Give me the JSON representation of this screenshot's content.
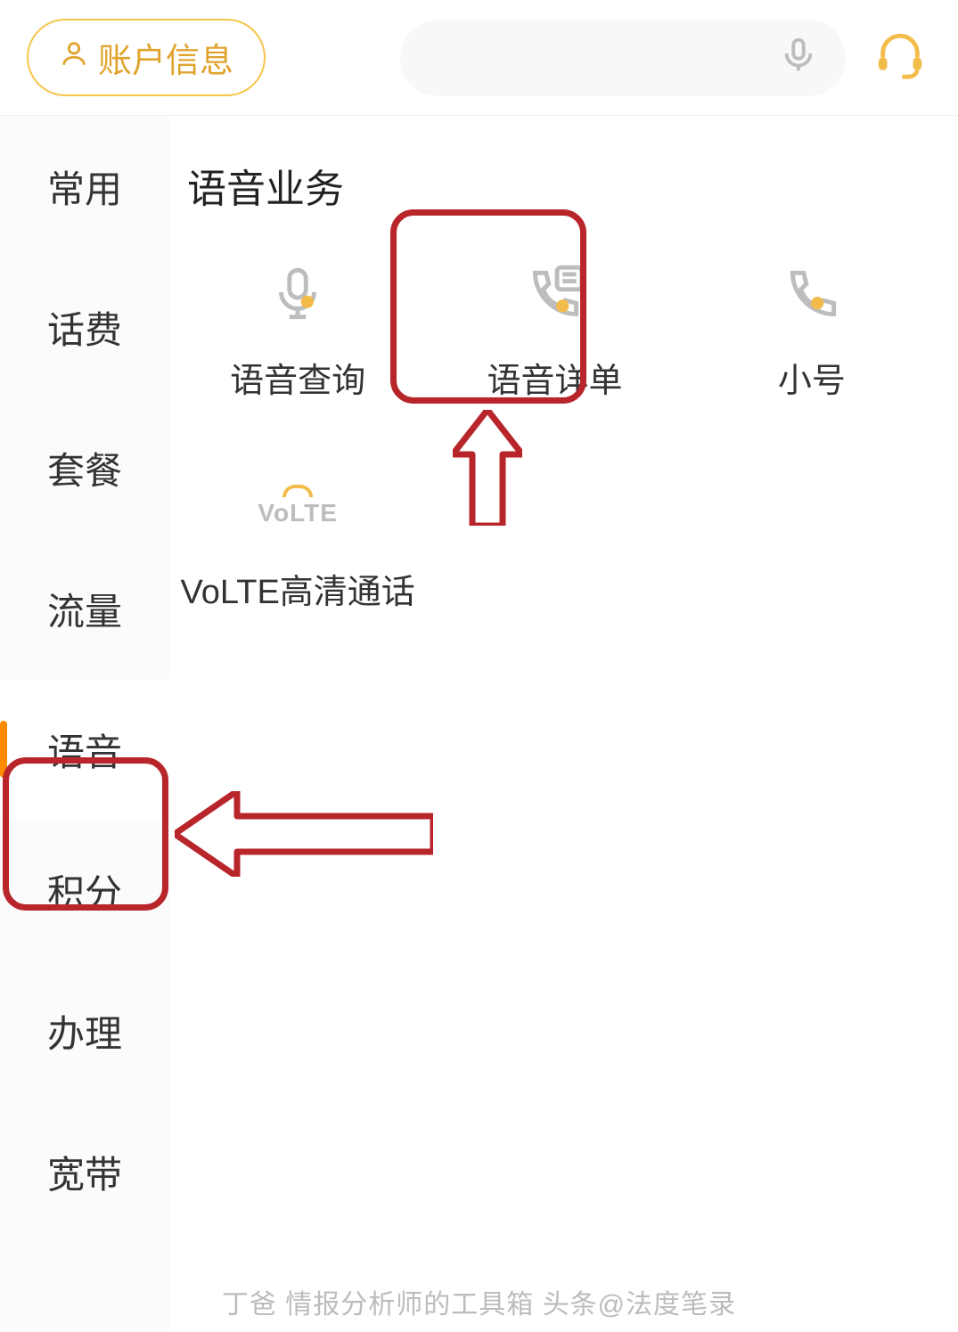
{
  "header": {
    "account_label": "账户信息"
  },
  "sidebar": {
    "items": [
      {
        "label": "常用",
        "active": false
      },
      {
        "label": "话费",
        "active": false
      },
      {
        "label": "套餐",
        "active": false
      },
      {
        "label": "流量",
        "active": false
      },
      {
        "label": "语音",
        "active": true
      },
      {
        "label": "积分",
        "active": false
      },
      {
        "label": "办理",
        "active": false
      },
      {
        "label": "宽带",
        "active": false
      }
    ]
  },
  "main": {
    "section_title": "语音业务",
    "grid": [
      {
        "label": "语音查询",
        "icon": "mic-icon"
      },
      {
        "label": "语音详单",
        "icon": "call-list-icon"
      },
      {
        "label": "小号",
        "icon": "phone-icon"
      },
      {
        "label": "VoLTE高清通话",
        "icon": "volte-icon"
      }
    ]
  },
  "watermark": "丁爸 情报分析师的工具箱  头条@法度笔录",
  "icons": {
    "mic": "mic-icon",
    "headset": "headset-icon",
    "user": "user-icon",
    "call_list": "call-list-icon",
    "phone": "phone-icon",
    "volte": "volte-icon"
  },
  "colors": {
    "accent": "#f3bc4a",
    "accent_dark": "#e0a42e",
    "side_active_bar": "#ff8a00",
    "annotation_red": "#b8252b",
    "icon_gray": "#bdbdbd"
  }
}
